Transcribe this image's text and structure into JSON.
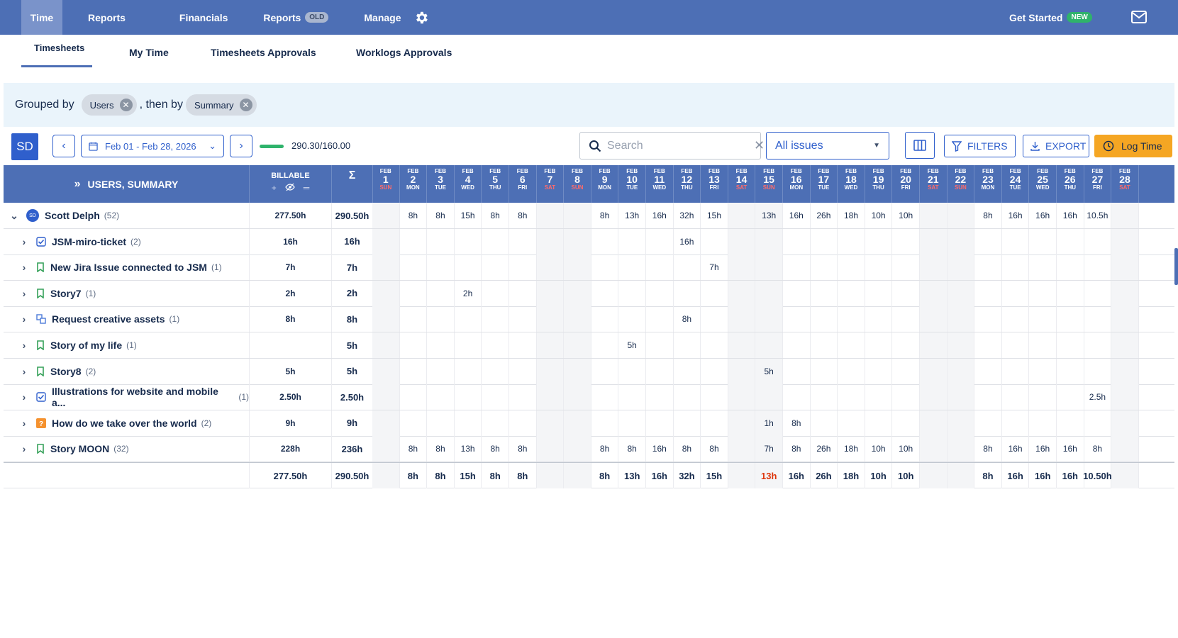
{
  "nav": {
    "items": [
      "Time",
      "Reports",
      "Financials",
      "Reports",
      "Manage"
    ],
    "old_badge": "OLD",
    "get_started": "Get Started",
    "new_badge": "NEW"
  },
  "subtabs": [
    "Timesheets",
    "My Time",
    "Timesheets Approvals",
    "Worklogs Approvals"
  ],
  "grouping": {
    "prefix": "Grouped by",
    "first": "Users",
    "then": ", then by",
    "second": "Summary"
  },
  "toolbar": {
    "user_initials": "SD",
    "date_range": "Feb 01 - Feb 28, 2026",
    "progress_fraction": 1.0,
    "progress_text": "290.30/160.00",
    "search_placeholder": "Search",
    "issue_filter": "All issues",
    "filters_label": "FILTERS",
    "export_label": "EXPORT",
    "log_time_label": "Log Time"
  },
  "grid": {
    "first_header": "USERS, SUMMARY",
    "billable_header": "BILLABLE",
    "sigma_header": "Σ",
    "month": "FEB",
    "days": [
      {
        "n": "1",
        "d": "SUN",
        "w": true
      },
      {
        "n": "2",
        "d": "MON",
        "w": false
      },
      {
        "n": "3",
        "d": "TUE",
        "w": false
      },
      {
        "n": "4",
        "d": "WED",
        "w": false
      },
      {
        "n": "5",
        "d": "THU",
        "w": false
      },
      {
        "n": "6",
        "d": "FRI",
        "w": false
      },
      {
        "n": "7",
        "d": "SAT",
        "w": true
      },
      {
        "n": "8",
        "d": "SUN",
        "w": true
      },
      {
        "n": "9",
        "d": "MON",
        "w": false
      },
      {
        "n": "10",
        "d": "TUE",
        "w": false
      },
      {
        "n": "11",
        "d": "WED",
        "w": false
      },
      {
        "n": "12",
        "d": "THU",
        "w": false
      },
      {
        "n": "13",
        "d": "FRI",
        "w": false
      },
      {
        "n": "14",
        "d": "SAT",
        "w": true
      },
      {
        "n": "15",
        "d": "SUN",
        "w": true
      },
      {
        "n": "16",
        "d": "MON",
        "w": false
      },
      {
        "n": "17",
        "d": "TUE",
        "w": false
      },
      {
        "n": "18",
        "d": "WED",
        "w": false
      },
      {
        "n": "19",
        "d": "THU",
        "w": false
      },
      {
        "n": "20",
        "d": "FRI",
        "w": false
      },
      {
        "n": "21",
        "d": "SAT",
        "w": true
      },
      {
        "n": "22",
        "d": "SUN",
        "w": true
      },
      {
        "n": "23",
        "d": "MON",
        "w": false
      },
      {
        "n": "24",
        "d": "TUE",
        "w": false
      },
      {
        "n": "25",
        "d": "WED",
        "w": false
      },
      {
        "n": "26",
        "d": "THU",
        "w": false
      },
      {
        "n": "27",
        "d": "FRI",
        "w": false
      },
      {
        "n": "28",
        "d": "SAT",
        "w": true
      }
    ],
    "rows": [
      {
        "type": "user",
        "name": "Scott Delph",
        "initials": "SD",
        "count": "(52)",
        "billable": "277.50h",
        "total": "290.50h",
        "values": [
          "",
          "8h",
          "8h",
          "15h",
          "8h",
          "8h",
          "",
          "",
          "8h",
          "13h",
          "16h",
          "32h",
          "15h",
          "",
          "13h",
          "16h",
          "26h",
          "18h",
          "10h",
          "10h",
          "",
          "",
          "8h",
          "16h",
          "16h",
          "16h",
          "10.5h",
          ""
        ]
      },
      {
        "type": "issue",
        "icon": "task",
        "name": "JSM-miro-ticket",
        "count": "(2)",
        "billable": "16h",
        "total": "16h",
        "values": [
          "",
          "",
          "",
          "",
          "",
          "",
          "",
          "",
          "",
          "",
          "",
          "16h",
          "",
          "",
          "",
          "",
          "",
          "",
          "",
          "",
          "",
          "",
          "",
          "",
          "",
          "",
          "",
          ""
        ]
      },
      {
        "type": "issue",
        "icon": "story",
        "name": "New Jira Issue connected to JSM",
        "count": "(1)",
        "billable": "7h",
        "total": "7h",
        "values": [
          "",
          "",
          "",
          "",
          "",
          "",
          "",
          "",
          "",
          "",
          "",
          "",
          "7h",
          "",
          "",
          "",
          "",
          "",
          "",
          "",
          "",
          "",
          "",
          "",
          "",
          "",
          "",
          ""
        ]
      },
      {
        "type": "issue",
        "icon": "story",
        "name": "Story7",
        "count": "(1)",
        "billable": "2h",
        "total": "2h",
        "values": [
          "",
          "",
          "",
          "2h",
          "",
          "",
          "",
          "",
          "",
          "",
          "",
          "",
          "",
          "",
          "",
          "",
          "",
          "",
          "",
          "",
          "",
          "",
          "",
          "",
          "",
          "",
          "",
          ""
        ]
      },
      {
        "type": "issue",
        "icon": "subtask",
        "name": "Request creative assets",
        "count": "(1)",
        "billable": "8h",
        "total": "8h",
        "values": [
          "",
          "",
          "",
          "",
          "",
          "",
          "",
          "",
          "",
          "",
          "",
          "8h",
          "",
          "",
          "",
          "",
          "",
          "",
          "",
          "",
          "",
          "",
          "",
          "",
          "",
          "",
          "",
          ""
        ]
      },
      {
        "type": "issue",
        "icon": "story",
        "name": "Story of my life",
        "count": "(1)",
        "billable": "",
        "total": "5h",
        "values": [
          "",
          "",
          "",
          "",
          "",
          "",
          "",
          "",
          "",
          "5h",
          "",
          "",
          "",
          "",
          "",
          "",
          "",
          "",
          "",
          "",
          "",
          "",
          "",
          "",
          "",
          "",
          "",
          ""
        ]
      },
      {
        "type": "issue",
        "icon": "story",
        "name": "Story8",
        "count": "(2)",
        "billable": "5h",
        "total": "5h",
        "values": [
          "",
          "",
          "",
          "",
          "",
          "",
          "",
          "",
          "",
          "",
          "",
          "",
          "",
          "",
          "5h",
          "",
          "",
          "",
          "",
          "",
          "",
          "",
          "",
          "",
          "",
          "",
          "",
          ""
        ]
      },
      {
        "type": "issue",
        "icon": "task",
        "name": "Illustrations for website and mobile a...",
        "count": "(1)",
        "billable": "2.50h",
        "total": "2.50h",
        "values": [
          "",
          "",
          "",
          "",
          "",
          "",
          "",
          "",
          "",
          "",
          "",
          "",
          "",
          "",
          "",
          "",
          "",
          "",
          "",
          "",
          "",
          "",
          "",
          "",
          "",
          "",
          "2.5h",
          ""
        ]
      },
      {
        "type": "issue",
        "icon": "question",
        "name": "How do we take over the world",
        "count": "(2)",
        "billable": "9h",
        "total": "9h",
        "values": [
          "",
          "",
          "",
          "",
          "",
          "",
          "",
          "",
          "",
          "",
          "",
          "",
          "",
          "",
          "1h",
          "8h",
          "",
          "",
          "",
          "",
          "",
          "",
          "",
          "",
          "",
          "",
          "",
          ""
        ]
      },
      {
        "type": "issue",
        "icon": "story",
        "name": "Story MOON",
        "count": "(32)",
        "billable": "228h",
        "total": "236h",
        "values": [
          "",
          "8h",
          "8h",
          "13h",
          "8h",
          "8h",
          "",
          "",
          "8h",
          "8h",
          "16h",
          "8h",
          "8h",
          "",
          "7h",
          "8h",
          "26h",
          "18h",
          "10h",
          "10h",
          "",
          "",
          "8h",
          "16h",
          "16h",
          "16h",
          "8h",
          ""
        ]
      }
    ],
    "totals": {
      "billable": "277.50h",
      "total": "290.50h",
      "values": [
        "",
        "8h",
        "8h",
        "15h",
        "8h",
        "8h",
        "",
        "",
        "8h",
        "13h",
        "16h",
        "32h",
        "15h",
        "",
        "13h",
        "16h",
        "26h",
        "18h",
        "10h",
        "10h",
        "",
        "",
        "8h",
        "16h",
        "16h",
        "16h",
        "10.50h",
        ""
      ],
      "highlight_index": 14
    }
  }
}
